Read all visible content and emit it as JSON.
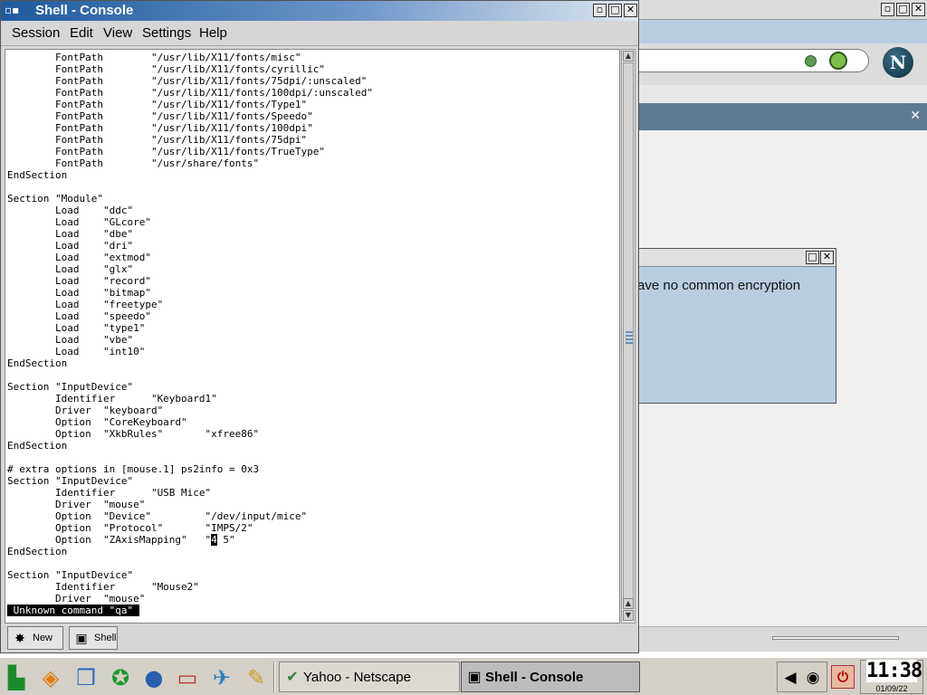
{
  "console_window": {
    "title": "Shell - Console",
    "controls": {
      "minimize": "▫",
      "maximize": "□",
      "close": "✕"
    },
    "menu": [
      "Session",
      "Edit",
      "View",
      "Settings",
      "Help"
    ],
    "terminal_lines": [
      "        FontPath        \"/usr/lib/X11/fonts/misc\"",
      "        FontPath        \"/usr/lib/X11/fonts/cyrillic\"",
      "        FontPath        \"/usr/lib/X11/fonts/75dpi/:unscaled\"",
      "        FontPath        \"/usr/lib/X11/fonts/100dpi/:unscaled\"",
      "        FontPath        \"/usr/lib/X11/fonts/Type1\"",
      "        FontPath        \"/usr/lib/X11/fonts/Speedo\"",
      "        FontPath        \"/usr/lib/X11/fonts/100dpi\"",
      "        FontPath        \"/usr/lib/X11/fonts/75dpi\"",
      "        FontPath        \"/usr/lib/X11/fonts/TrueType\"",
      "        FontPath        \"/usr/share/fonts\"",
      "EndSection",
      "",
      "Section \"Module\"",
      "        Load    \"ddc\"",
      "        Load    \"GLcore\"",
      "        Load    \"dbe\"",
      "        Load    \"dri\"",
      "        Load    \"extmod\"",
      "        Load    \"glx\"",
      "        Load    \"record\"",
      "        Load    \"bitmap\"",
      "        Load    \"freetype\"",
      "        Load    \"speedo\"",
      "        Load    \"type1\"",
      "        Load    \"vbe\"",
      "        Load    \"int10\"",
      "EndSection",
      "",
      "Section \"InputDevice\"",
      "        Identifier      \"Keyboard1\"",
      "        Driver  \"keyboard\"",
      "        Option  \"CoreKeyboard\"",
      "        Option  \"XkbRules\"       \"xfree86\"",
      "EndSection",
      "",
      "# extra options in [mouse.1] ps2info = 0x3",
      "Section \"InputDevice\"",
      "        Identifier      \"USB Mice\"",
      "        Driver  \"mouse\"",
      "        Option  \"Device\"         \"/dev/input/mice\"",
      "        Option  \"Protocol\"       \"IMPS/2\"",
      "        Option  \"ZAxisMapping\"   \"",
      "EndSection",
      "",
      "Section \"InputDevice\"",
      "        Identifier      \"Mouse2\"",
      "        Driver  \"mouse\""
    ],
    "cursor_line_cursor_char": "4",
    "cursor_line_rest": " 5\"",
    "status_message": " Unknown command \"qa\" ",
    "tabs": {
      "new_label": "New",
      "shell_label": "Shell"
    }
  },
  "netscape_window": {
    "controls": {
      "minimize": "▫",
      "maximize": "□",
      "close": "✕"
    },
    "logo_letter": "N",
    "sidebar_close": "✕"
  },
  "ssl_dialog": {
    "message": "ave no common encryption",
    "controls": {
      "maximize": "□",
      "close": "✕"
    }
  },
  "taskbar": {
    "tasks": [
      {
        "label": "Yahoo - Netscape",
        "icon": "netscape-icon",
        "active": false
      },
      {
        "label": "Shell - Console",
        "icon": "console-icon",
        "active": true
      }
    ],
    "clock_time": "11:38",
    "clock_date": "01/09/22"
  }
}
